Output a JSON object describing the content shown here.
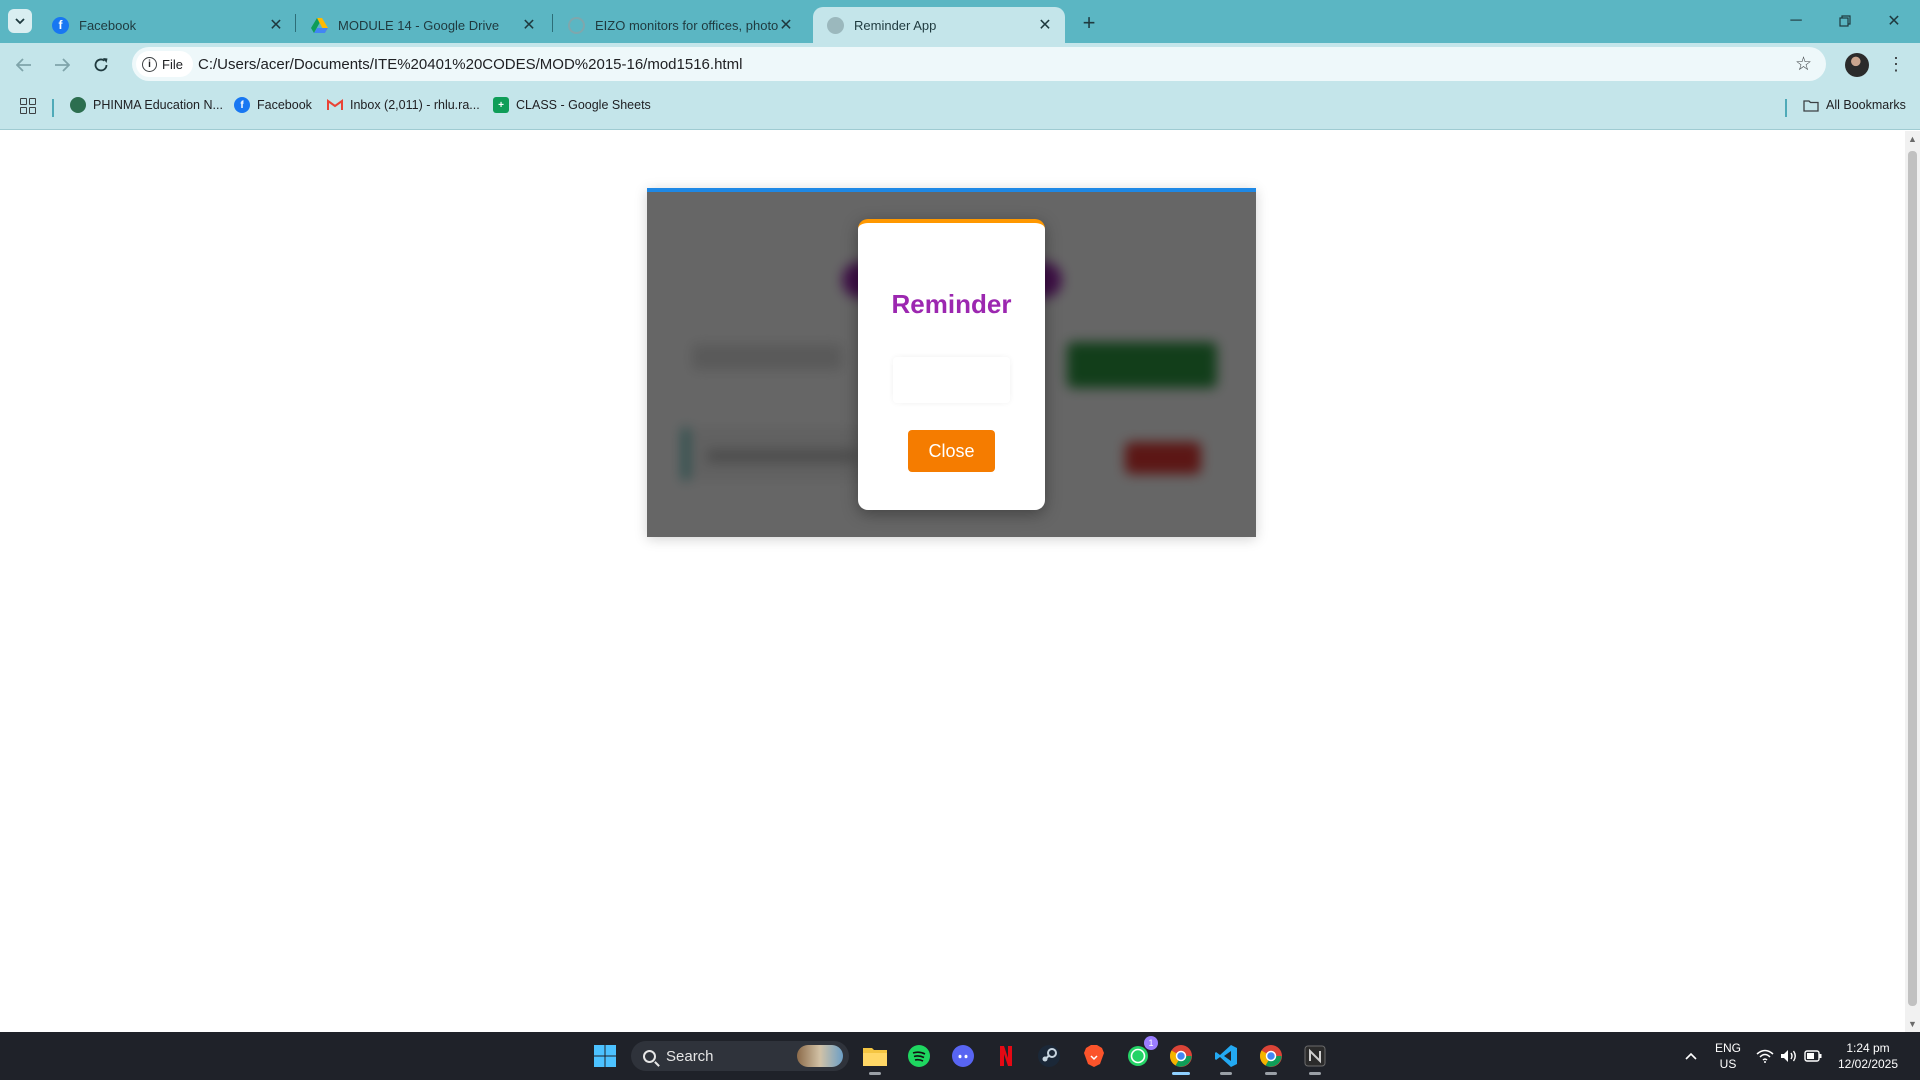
{
  "browser": {
    "tabs": [
      {
        "title": "Facebook",
        "icon": "facebook-icon"
      },
      {
        "title": "MODULE 14 - Google Drive",
        "icon": "google-drive-icon"
      },
      {
        "title": "EIZO monitors for offices, photos",
        "icon": "loading-icon"
      },
      {
        "title": "Reminder App",
        "icon": "globe-icon",
        "active": true
      }
    ],
    "address": {
      "chip_label": "File",
      "url": "C:/Users/acer/Documents/ITE%20401%20CODES/MOD%2015-16/mod1516.html"
    },
    "bookmarks": [
      {
        "label": "PHINMA Education N...",
        "icon": "phinma-icon"
      },
      {
        "label": "Facebook",
        "icon": "facebook-icon"
      },
      {
        "label": "Inbox (2,011) - rhlu.ra...",
        "icon": "gmail-icon"
      },
      {
        "label": "CLASS - Google Sheets",
        "icon": "google-sheets-icon"
      }
    ],
    "all_bookmarks_label": "All Bookmarks"
  },
  "modal": {
    "title": "Reminder",
    "message": "",
    "close_label": "Close"
  },
  "taskbar": {
    "search_label": "Search",
    "language": "ENG",
    "region": "US",
    "time": "1:24 pm",
    "date": "12/02/2025",
    "whatsapp_badge": "1"
  },
  "colors": {
    "tab_strip": "#5bb6c3",
    "toolbar": "#c4e5ea",
    "modal_title": "#9c27b0",
    "modal_accent": "#ff9800",
    "close_button": "#f57c00",
    "card_accent": "#1e88e5"
  }
}
